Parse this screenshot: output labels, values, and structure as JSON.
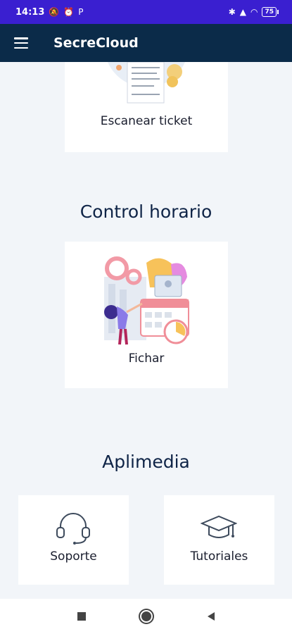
{
  "status": {
    "time": "14:13",
    "battery": "75"
  },
  "appbar": {
    "title": "SecreCloud"
  },
  "cards": {
    "scan_ticket": "Escanear ticket",
    "fichar": "Fichar",
    "soporte": "Soporte",
    "tutoriales": "Tutoriales"
  },
  "sections": {
    "control_horario": "Control horario",
    "aplimedia": "Aplimedia"
  },
  "icons": {
    "menu": "hamburger-icon",
    "headset": "headset-icon",
    "graduation": "graduation-cap-icon",
    "nav_recent": "square-icon",
    "nav_home": "circle-icon",
    "nav_back": "triangle-back-icon"
  },
  "colors": {
    "statusbar": "#3a1fd0",
    "appbar": "#0b2b49",
    "background": "#f2f5f9"
  }
}
